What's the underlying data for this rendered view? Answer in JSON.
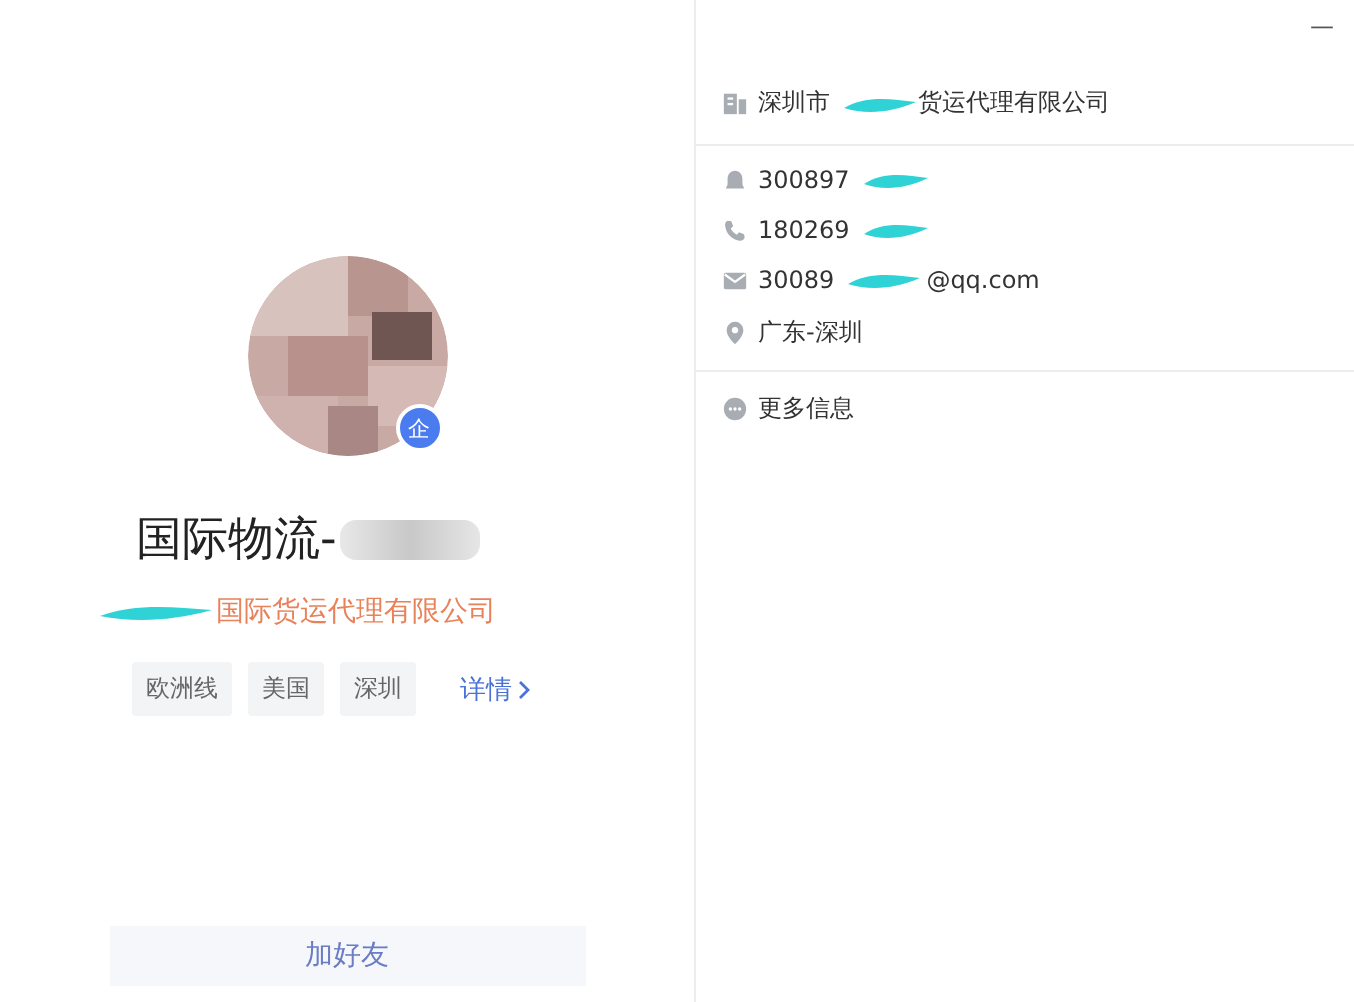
{
  "window": {
    "minimize": "—"
  },
  "profile": {
    "badge": "企",
    "name": "国际物流-",
    "company": "国际货运代理有限公司",
    "tags": [
      "欧洲线",
      "美国",
      "深圳"
    ],
    "details_link": "详情",
    "add_button": "加好友"
  },
  "info": {
    "company": {
      "prefix": "深圳市",
      "suffix": "货运代理有限公司"
    },
    "contacts": [
      {
        "kind": "qq",
        "before": "300897"
      },
      {
        "kind": "phone",
        "before": "180269"
      },
      {
        "kind": "email",
        "before": "30089",
        "after": "@qq.com"
      },
      {
        "kind": "location",
        "before": "广东-深圳"
      }
    ],
    "more": "更多信息"
  }
}
